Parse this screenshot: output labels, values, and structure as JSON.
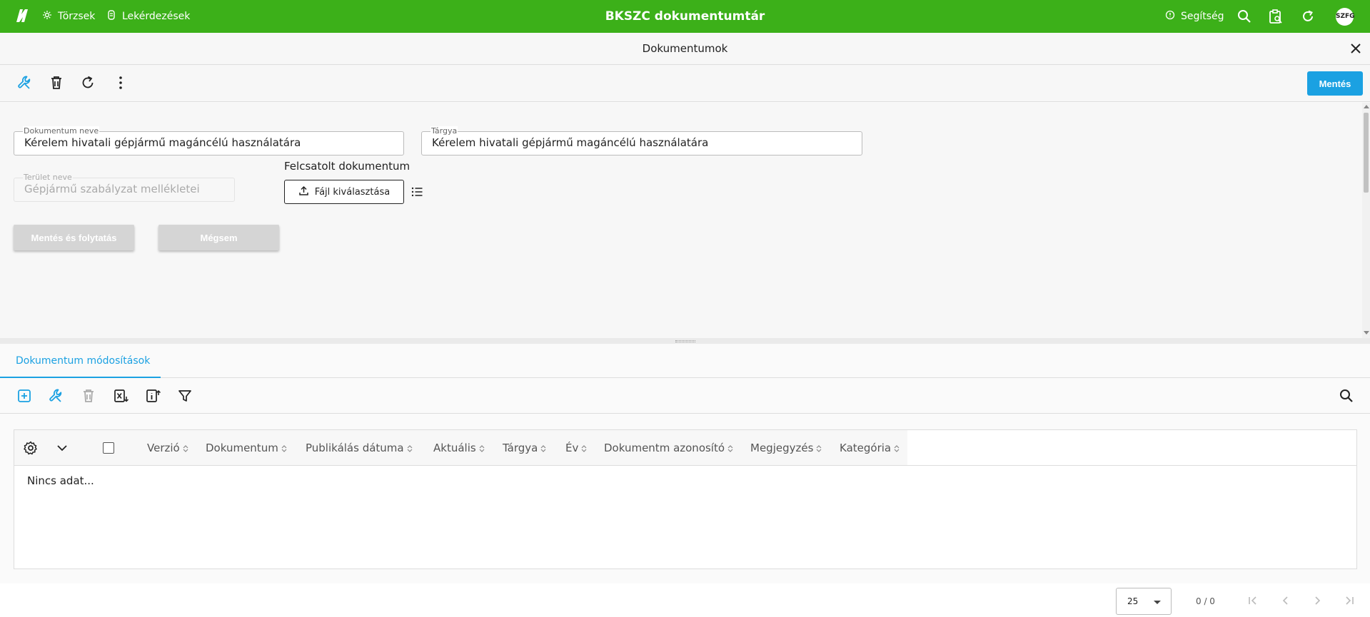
{
  "app": {
    "title": "BKSZC dokumentumtár",
    "nav": {
      "torzsek": "Törzsek",
      "lekerdezesek": "Lekérdezések"
    },
    "help": "Segítség",
    "user_initials": "SZFG"
  },
  "panel": {
    "title": "Dokumentumok",
    "save_label": "Mentés"
  },
  "form": {
    "doc_name": {
      "label": "Dokumentum neve",
      "value": "Kérelem hivatali gépjármű magáncélú használatára"
    },
    "subject": {
      "label": "Tárgya",
      "value": "Kérelem hivatali gépjármű magáncélú használatára"
    },
    "area_name": {
      "label": "Terület neve",
      "value": "Gépjármű szabályzat mellékletei"
    },
    "attached_label": "Felcsatolt dokumentum",
    "file_select": "Fájl kiválasztása",
    "save_continue": "Mentés és folytatás",
    "cancel": "Mégsem"
  },
  "tabs": [
    {
      "label": "Dokumentum módosítások",
      "active": true
    }
  ],
  "grid": {
    "columns": [
      "Verzió",
      "Dokumentum",
      "Publikálás dátuma",
      "Aktuális",
      "Tárgya",
      "Év",
      "Dokumentm azonosító",
      "Megjegyzés",
      "Kategória"
    ],
    "empty_text": "Nincs adat..."
  },
  "pager": {
    "page_size": "25",
    "info": "0 / 0"
  },
  "colors": {
    "topbar": "#3cb019",
    "accent": "#1ba1e2"
  },
  "icons": [
    "logo-icon",
    "torzsek-icon",
    "lekerdezesek-icon",
    "help-icon",
    "search-icon",
    "clipboard-search-icon",
    "refresh-icon",
    "close-icon",
    "wrench-icon",
    "trash-icon",
    "more-vert-icon",
    "upload-icon",
    "list-icon",
    "add-icon",
    "excel-export-icon",
    "info-export-icon",
    "filter-icon",
    "settings-icon",
    "chevron-down-icon",
    "first-page-icon",
    "prev-page-icon",
    "next-page-icon",
    "last-page-icon"
  ]
}
